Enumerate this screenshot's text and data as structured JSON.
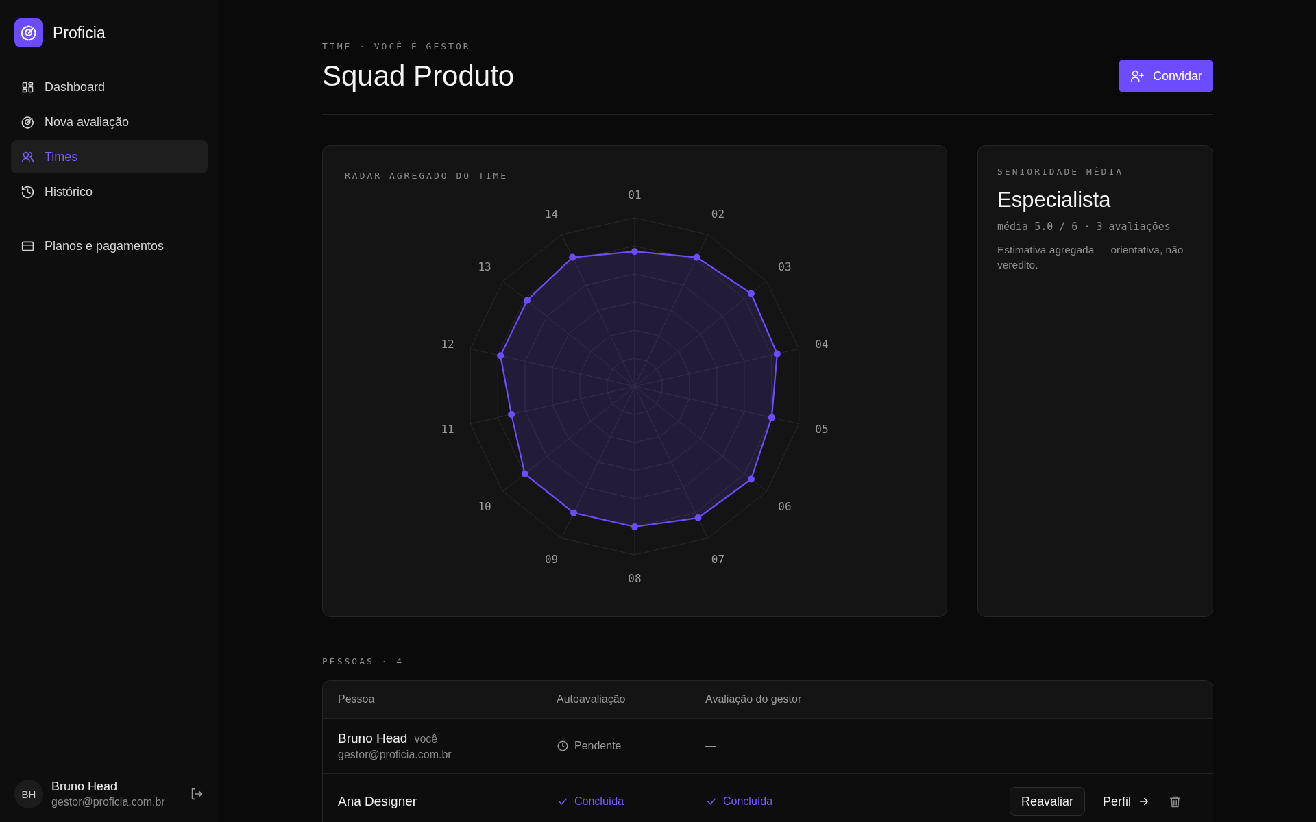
{
  "sidebar": {
    "brand": "Proficia",
    "nav": [
      {
        "label": "Dashboard",
        "kind": "grid",
        "selected": false
      },
      {
        "label": "Nova avaliação",
        "kind": "target",
        "selected": false
      },
      {
        "label": "Times",
        "kind": "users",
        "selected": true
      },
      {
        "label": "Histórico",
        "kind": "history",
        "selected": false
      }
    ],
    "nav_secondary": [
      {
        "label": "Planos e pagamentos",
        "kind": "card",
        "selected": false
      }
    ],
    "user": {
      "initials": "BH",
      "name": "Bruno Head",
      "email": "gestor@proficia.com.br"
    }
  },
  "header": {
    "eyebrow": "TIME · VOCÊ É GESTOR",
    "title": "Squad Produto",
    "action": "Convidar"
  },
  "radar": {
    "title": "RADAR AGREGADO DO TIME",
    "axes": [
      "01",
      "02",
      "03",
      "04",
      "05",
      "06",
      "07",
      "08",
      "09",
      "10",
      "11",
      "12",
      "13",
      "14"
    ]
  },
  "seniority": {
    "label": "SENIORIDADE MÉDIA",
    "level_name": "Especialista",
    "stats": "média 5.0 / 6 · 3 avaliações",
    "note": "Estimativa agregada — orientativa, não veredito."
  },
  "people": {
    "heading": "PESSOAS · 4",
    "columns": [
      "Pessoa",
      "Autoavaliação",
      "Avaliação do gestor"
    ],
    "rows": [
      {
        "name": "Bruno Head",
        "tag": "você",
        "email": "gestor@proficia.com.br",
        "self_status": {
          "kind": "pending",
          "label": "Pendente"
        },
        "manager_status": {
          "kind": "none",
          "label": "—"
        },
        "actions": []
      },
      {
        "name": "Ana Designer",
        "self_status": {
          "kind": "done",
          "label": "Concluída"
        },
        "manager_status": {
          "kind": "done",
          "label": "Concluída"
        },
        "actions": [
          {
            "kind": "secondary",
            "label": "Reavaliar"
          },
          {
            "kind": "link",
            "label": "Perfil"
          },
          {
            "kind": "delete"
          }
        ]
      }
    ]
  }
}
